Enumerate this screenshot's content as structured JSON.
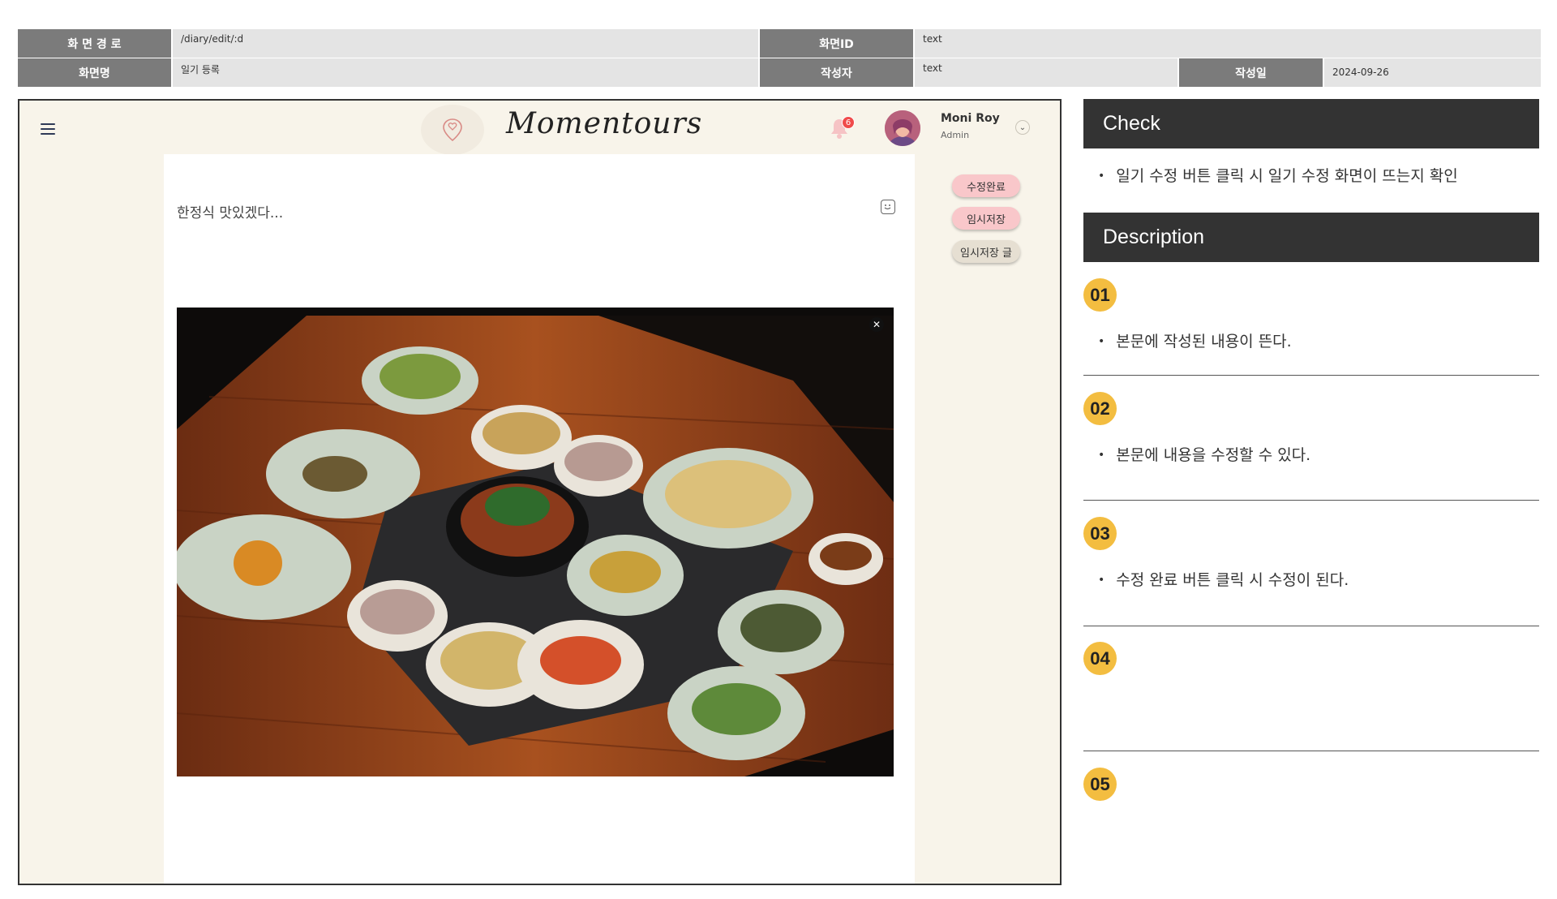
{
  "spec": {
    "path_label": "화 면 경 로",
    "path_value": "/diary/edit/:d",
    "screen_id_label": "화면ID",
    "screen_id_value": "text",
    "screen_name_label": "화면명",
    "screen_name_value": "일기 등록",
    "author_label": "작성자",
    "author_value": "text",
    "date_label": "작성일",
    "date_value": "2024-09-26"
  },
  "app": {
    "brand": "Momentours",
    "notification_count": "6",
    "user_name": "Moni Roy",
    "user_role": "Admin",
    "body_text": "한정식 맛있겠다...",
    "buttons": {
      "complete": "수정완료",
      "temp_save": "임시저장",
      "temp_posts": "임시저장 글"
    },
    "icons": [
      "menu-icon",
      "logo-pin-icon",
      "bell-icon",
      "chevron-down-icon",
      "emoji-icon",
      "close-icon"
    ]
  },
  "panel": {
    "check_title": "Check",
    "check_items": [
      "일기 수정 버튼 클릭 시 일기 수정 화면이 뜨는지 확인"
    ],
    "description_title": "Description",
    "steps": [
      {
        "num": "01",
        "text": "본문에 작성된 내용이 뜬다."
      },
      {
        "num": "02",
        "text": "본문에 내용을 수정할 수 있다."
      },
      {
        "num": "03",
        "text": "수정 완료 버튼 클릭 시 수정이 된다."
      },
      {
        "num": "04",
        "text": ""
      },
      {
        "num": "05",
        "text": ""
      }
    ]
  },
  "colors": {
    "spec_label_bg": "#7b7b7b",
    "spec_value_bg": "#e4e4e4",
    "app_bg": "#f8f4ea",
    "pill_pink": "#f9c7ca",
    "badge_red": "#f04b4b",
    "section_header_bg": "#333333",
    "step_badge": "#f3bd40"
  }
}
